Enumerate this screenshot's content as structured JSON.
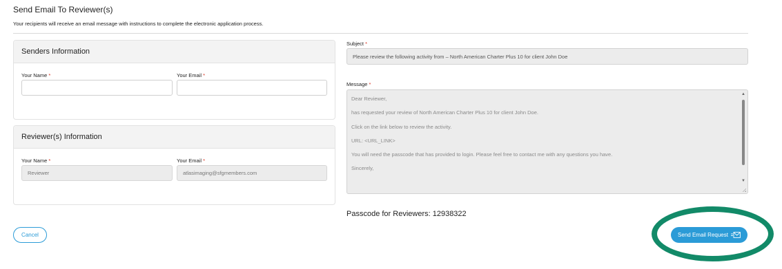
{
  "page": {
    "title": "Send Email To Reviewer(s)",
    "subtitle": "Your recipients will receive an email message with instructions to complete the electronic application process."
  },
  "senders": {
    "header": "Senders Information",
    "name_label": "Your Name",
    "name_value": "",
    "email_label": "Your Email",
    "email_value": ""
  },
  "reviewers": {
    "header": "Reviewer(s) Information",
    "name_label": "Your Name",
    "name_value": "Reviewer",
    "email_label": "Your Email",
    "email_value": "atlasimaging@sfgmembers.com"
  },
  "required_marker": "*",
  "subject": {
    "label": "Subject",
    "value": "Please review the following activity from  – North American Charter Plus 10 for client John Doe"
  },
  "message": {
    "label": "Message",
    "lines": [
      "Dear Reviewer,",
      " has requested your review of North American Charter Plus 10 for client John Doe.",
      "Click on the link below to review the activity.",
      "URL: <URL_LINK>",
      "You will need the passcode that  has provided to login. Please feel free to contact me with any questions you have.",
      "Sincerely,"
    ]
  },
  "passcode": {
    "text": "Passcode for Reviewers: 12938322"
  },
  "buttons": {
    "cancel": "Cancel",
    "send": "Send Email Request"
  },
  "colors": {
    "accent": "#2b9bd7",
    "highlight_ring": "#128a68",
    "required": "#d9301e"
  },
  "icons": {
    "send_button_icon": "email-send-icon"
  }
}
